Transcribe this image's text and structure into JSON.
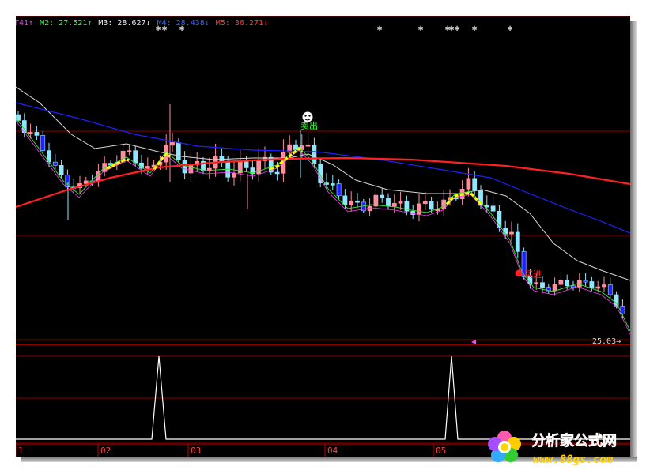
{
  "legend": [
    {
      "label": "T41",
      "color": "#ff2aff",
      "arrow": "up"
    },
    {
      "label": "M2: 27.521",
      "color": "#33ff33",
      "arrow": "up"
    },
    {
      "label": "M3: 28.627",
      "color": "#e8e8e8",
      "arrow": "down"
    },
    {
      "label": "M4: 28.438",
      "color": "#3366ff",
      "arrow": "down"
    },
    {
      "label": "M5: 36.271",
      "color": "#ff3333",
      "arrow": "down"
    }
  ],
  "signals": {
    "sell": "卖出",
    "buy": "买进"
  },
  "price_label": "25.03",
  "colors": {
    "up": "#ff8f9f",
    "down": "#8fe6ff",
    "ma_blue": "#2020ff",
    "ma_red": "#ff2020",
    "grid": "#8c0000"
  },
  "chart_data": {
    "type": "candlestick",
    "x_ticks": [
      "1",
      "02",
      "03",
      "04",
      "05"
    ],
    "y_reference": 25.03,
    "moving_averages": [
      "M2",
      "M3",
      "M4",
      "M5"
    ],
    "indicator_peaks": [
      "02",
      "05"
    ]
  },
  "watermark": {
    "title": "分析家公式网",
    "url": "www.88gs.com"
  }
}
